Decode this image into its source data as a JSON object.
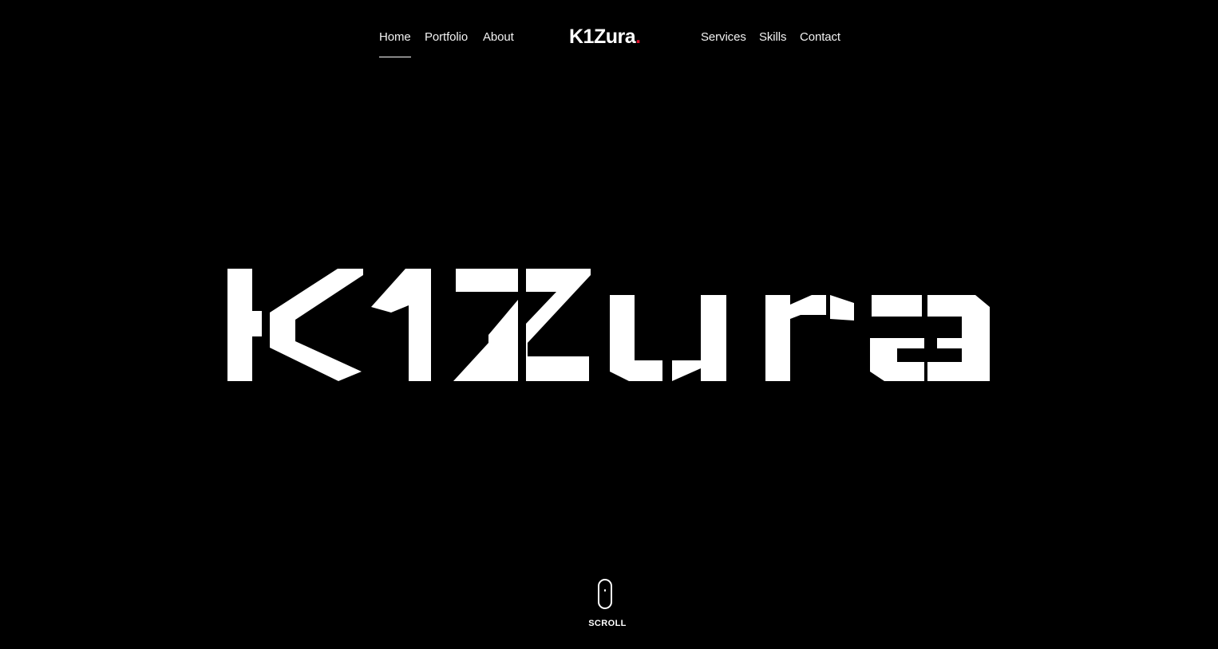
{
  "nav": {
    "left": [
      {
        "label": "Home",
        "active": true
      },
      {
        "label": "Portfolio",
        "active": false
      },
      {
        "label": "About",
        "active": false
      }
    ],
    "right": [
      {
        "label": "Services",
        "active": false
      },
      {
        "label": "Skills",
        "active": false
      },
      {
        "label": "Contact",
        "active": false
      }
    ],
    "brand": {
      "text": "K1Zura",
      "dot": ".",
      "dot_color": "#e0102a"
    }
  },
  "hero": {
    "logo_text": "K1Zura",
    "color": "#ffffff",
    "background": "#000000"
  },
  "scroll": {
    "label": "SCROLL",
    "icon": "mouse-icon"
  }
}
